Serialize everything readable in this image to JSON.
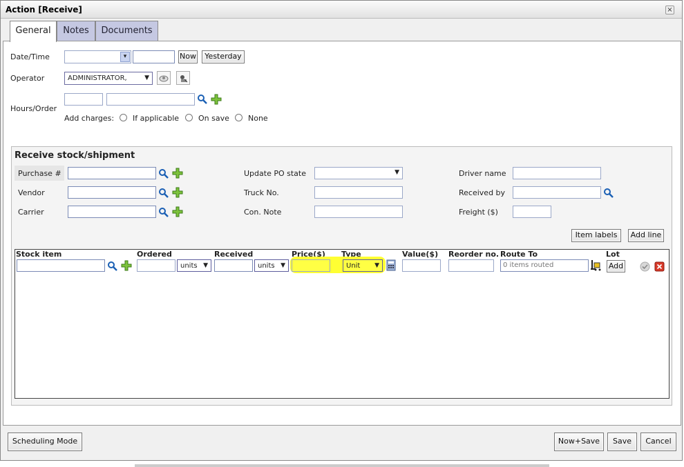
{
  "window": {
    "title": "Action [Receive]",
    "close_label": "×"
  },
  "tabs": [
    {
      "label": "General"
    },
    {
      "label": "Notes"
    },
    {
      "label": "Documents"
    }
  ],
  "general": {
    "date_label": "Date/Time",
    "now_label": "Now",
    "yesterday_label": "Yesterday",
    "operator_label": "Operator",
    "operator_value": "ADMINISTRATOR,",
    "hours_label": "Hours/Order",
    "add_charges_label": "Add charges:",
    "charge_options": [
      "If applicable",
      "On save",
      "None"
    ]
  },
  "receive": {
    "title": "Receive stock/shipment",
    "purchase_label": "Purchase #",
    "vendor_label": "Vendor",
    "carrier_label": "Carrier",
    "update_po_label": "Update PO state",
    "truck_label": "Truck No.",
    "con_note_label": "Con. Note",
    "driver_label": "Driver name",
    "received_by_label": "Received by",
    "freight_label": "Freight ($)",
    "item_labels_btn": "Item labels",
    "add_line_btn": "Add line"
  },
  "grid": {
    "headers": {
      "stock_item": "Stock item",
      "ordered": "Ordered",
      "received": "Received",
      "price": "Price($)",
      "type": "Type",
      "value": "Value($)",
      "reorder": "Reorder no.",
      "route_to": "Route To",
      "lot": "Lot"
    },
    "ordered_unit": "units",
    "received_unit": "units",
    "type_value": "Unit",
    "route_placeholder": "0 items routed",
    "lot_add": "Add"
  },
  "footer": {
    "scheduling": "Scheduling Mode",
    "now_save": "Now+Save",
    "save": "Save",
    "cancel": "Cancel"
  },
  "colors": {
    "highlight": "#ffff33",
    "tab_inactive": "#c5c8e2"
  }
}
